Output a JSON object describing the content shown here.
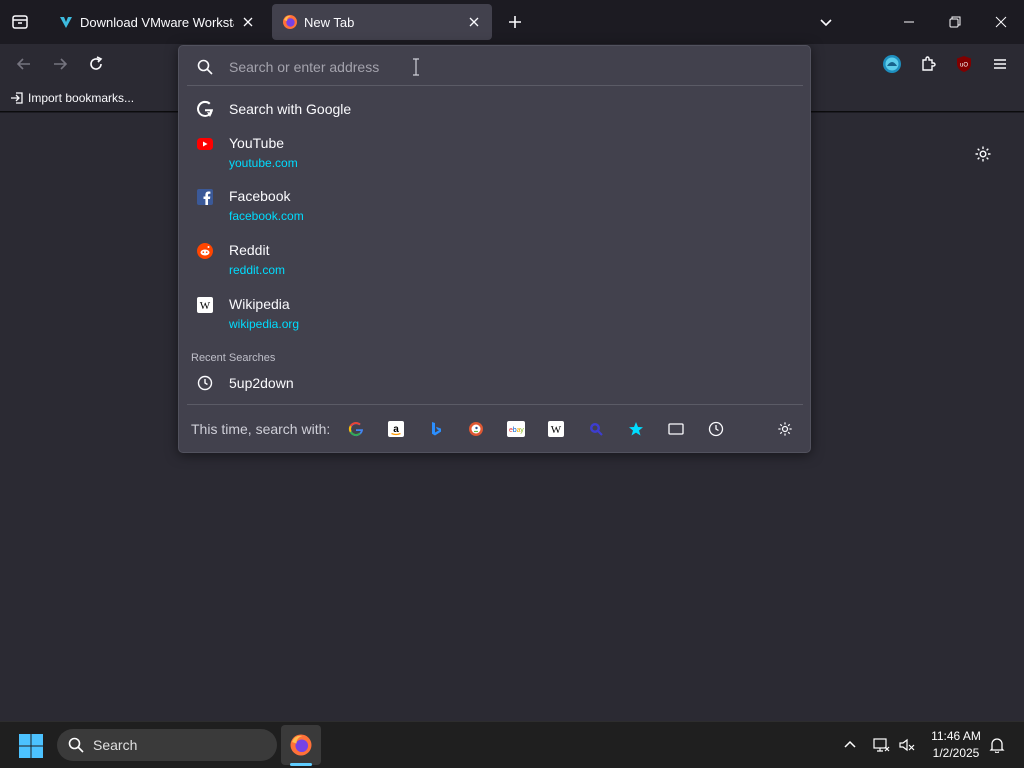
{
  "tabs": [
    {
      "title": "Download VMware Workstation",
      "favicon": "vmware-download-icon",
      "active": false
    },
    {
      "title": "New Tab",
      "favicon": "firefox-icon",
      "active": true
    }
  ],
  "bookmarks": {
    "import_label": "Import bookmarks..."
  },
  "urlbar": {
    "placeholder": "Search or enter address",
    "search_with_google": "Search with Google",
    "suggestions": [
      {
        "title": "YouTube",
        "url": "youtube.com",
        "icon": "youtube-icon"
      },
      {
        "title": "Facebook",
        "url": "facebook.com",
        "icon": "facebook-icon"
      },
      {
        "title": "Reddit",
        "url": "reddit.com",
        "icon": "reddit-icon"
      },
      {
        "title": "Wikipedia",
        "url": "wikipedia.org",
        "icon": "wikipedia-icon"
      }
    ],
    "recent_searches_label": "Recent Searches",
    "recent_searches": [
      {
        "text": "5up2down",
        "icon": "history-clock-icon"
      }
    ],
    "oneoff_label": "This time, search with:",
    "engines": [
      "google-icon",
      "amazon-icon",
      "bing-icon",
      "duckduckgo-icon",
      "ebay-icon",
      "wikipedia-icon",
      "perplexity-icon",
      "bookmarks-star-icon",
      "tabs-icon",
      "history-icon"
    ]
  },
  "taskbar": {
    "search_label": "Search",
    "time": "11:46 AM",
    "date": "1/2/2025"
  },
  "colors": {
    "accent_url": "#00ddff",
    "popup_bg": "#42414d",
    "page_bg": "#2b2a33",
    "tabstrip_bg": "#1c1b22",
    "taskbar_bg": "#1f1f1f"
  }
}
